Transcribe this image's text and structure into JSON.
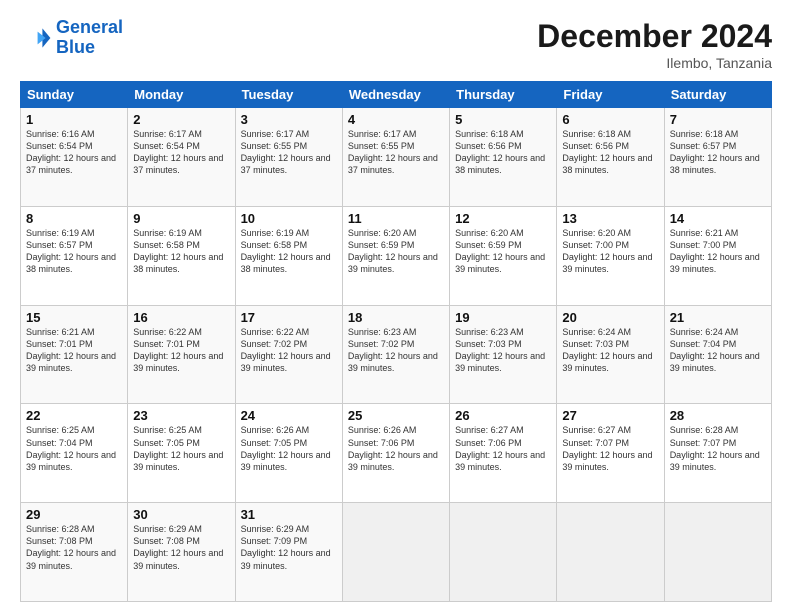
{
  "logo": {
    "line1": "General",
    "line2": "Blue"
  },
  "title": "December 2024",
  "subtitle": "Ilembo, Tanzania",
  "days_of_week": [
    "Sunday",
    "Monday",
    "Tuesday",
    "Wednesday",
    "Thursday",
    "Friday",
    "Saturday"
  ],
  "weeks": [
    [
      {
        "num": "1",
        "rise": "6:16 AM",
        "set": "6:54 PM",
        "daylight": "12 hours and 37 minutes."
      },
      {
        "num": "2",
        "rise": "6:17 AM",
        "set": "6:54 PM",
        "daylight": "12 hours and 37 minutes."
      },
      {
        "num": "3",
        "rise": "6:17 AM",
        "set": "6:55 PM",
        "daylight": "12 hours and 37 minutes."
      },
      {
        "num": "4",
        "rise": "6:17 AM",
        "set": "6:55 PM",
        "daylight": "12 hours and 37 minutes."
      },
      {
        "num": "5",
        "rise": "6:18 AM",
        "set": "6:56 PM",
        "daylight": "12 hours and 38 minutes."
      },
      {
        "num": "6",
        "rise": "6:18 AM",
        "set": "6:56 PM",
        "daylight": "12 hours and 38 minutes."
      },
      {
        "num": "7",
        "rise": "6:18 AM",
        "set": "6:57 PM",
        "daylight": "12 hours and 38 minutes."
      }
    ],
    [
      {
        "num": "8",
        "rise": "6:19 AM",
        "set": "6:57 PM",
        "daylight": "12 hours and 38 minutes."
      },
      {
        "num": "9",
        "rise": "6:19 AM",
        "set": "6:58 PM",
        "daylight": "12 hours and 38 minutes."
      },
      {
        "num": "10",
        "rise": "6:19 AM",
        "set": "6:58 PM",
        "daylight": "12 hours and 38 minutes."
      },
      {
        "num": "11",
        "rise": "6:20 AM",
        "set": "6:59 PM",
        "daylight": "12 hours and 39 minutes."
      },
      {
        "num": "12",
        "rise": "6:20 AM",
        "set": "6:59 PM",
        "daylight": "12 hours and 39 minutes."
      },
      {
        "num": "13",
        "rise": "6:20 AM",
        "set": "7:00 PM",
        "daylight": "12 hours and 39 minutes."
      },
      {
        "num": "14",
        "rise": "6:21 AM",
        "set": "7:00 PM",
        "daylight": "12 hours and 39 minutes."
      }
    ],
    [
      {
        "num": "15",
        "rise": "6:21 AM",
        "set": "7:01 PM",
        "daylight": "12 hours and 39 minutes."
      },
      {
        "num": "16",
        "rise": "6:22 AM",
        "set": "7:01 PM",
        "daylight": "12 hours and 39 minutes."
      },
      {
        "num": "17",
        "rise": "6:22 AM",
        "set": "7:02 PM",
        "daylight": "12 hours and 39 minutes."
      },
      {
        "num": "18",
        "rise": "6:23 AM",
        "set": "7:02 PM",
        "daylight": "12 hours and 39 minutes."
      },
      {
        "num": "19",
        "rise": "6:23 AM",
        "set": "7:03 PM",
        "daylight": "12 hours and 39 minutes."
      },
      {
        "num": "20",
        "rise": "6:24 AM",
        "set": "7:03 PM",
        "daylight": "12 hours and 39 minutes."
      },
      {
        "num": "21",
        "rise": "6:24 AM",
        "set": "7:04 PM",
        "daylight": "12 hours and 39 minutes."
      }
    ],
    [
      {
        "num": "22",
        "rise": "6:25 AM",
        "set": "7:04 PM",
        "daylight": "12 hours and 39 minutes."
      },
      {
        "num": "23",
        "rise": "6:25 AM",
        "set": "7:05 PM",
        "daylight": "12 hours and 39 minutes."
      },
      {
        "num": "24",
        "rise": "6:26 AM",
        "set": "7:05 PM",
        "daylight": "12 hours and 39 minutes."
      },
      {
        "num": "25",
        "rise": "6:26 AM",
        "set": "7:06 PM",
        "daylight": "12 hours and 39 minutes."
      },
      {
        "num": "26",
        "rise": "6:27 AM",
        "set": "7:06 PM",
        "daylight": "12 hours and 39 minutes."
      },
      {
        "num": "27",
        "rise": "6:27 AM",
        "set": "7:07 PM",
        "daylight": "12 hours and 39 minutes."
      },
      {
        "num": "28",
        "rise": "6:28 AM",
        "set": "7:07 PM",
        "daylight": "12 hours and 39 minutes."
      }
    ],
    [
      {
        "num": "29",
        "rise": "6:28 AM",
        "set": "7:08 PM",
        "daylight": "12 hours and 39 minutes."
      },
      {
        "num": "30",
        "rise": "6:29 AM",
        "set": "7:08 PM",
        "daylight": "12 hours and 39 minutes."
      },
      {
        "num": "31",
        "rise": "6:29 AM",
        "set": "7:09 PM",
        "daylight": "12 hours and 39 minutes."
      },
      null,
      null,
      null,
      null
    ]
  ]
}
